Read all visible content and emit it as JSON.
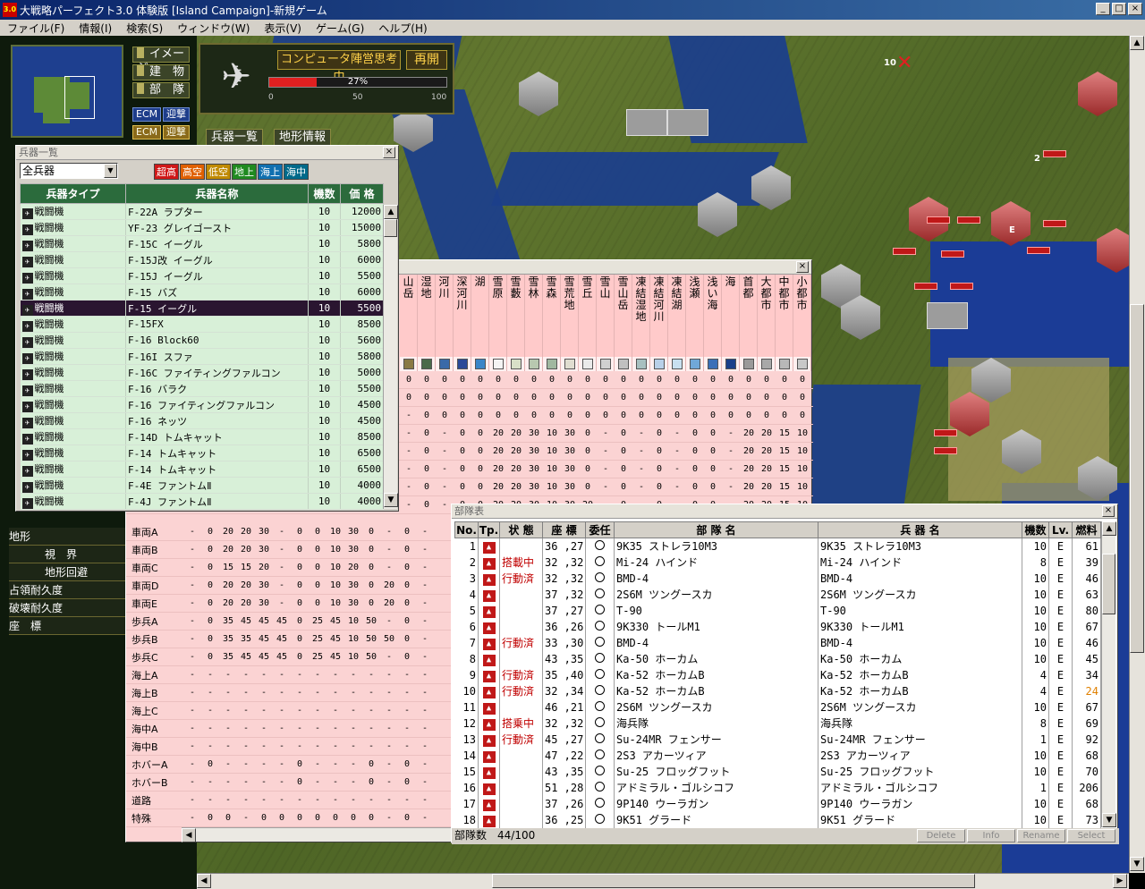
{
  "window": {
    "title": "大戦略パーフェクト3.0 体験版 [Island Campaign]-新規ゲーム",
    "app_icon": "3.0",
    "controls": [
      "_",
      "□",
      "×"
    ]
  },
  "menu": [
    "ファイル(F)",
    "情報(I)",
    "検索(S)",
    "ウィンドウ(W)",
    "表示(V)",
    "ゲーム(G)",
    "ヘルプ(H)"
  ],
  "side_buttons": [
    "イメージ",
    "建　物",
    "部　隊"
  ],
  "ecm_buttons": [
    [
      "ECM",
      "迎撃"
    ],
    [
      "ECM",
      "迎撃"
    ]
  ],
  "status": {
    "message": "コンピュータ陣営思考中",
    "resume": "再開",
    "progress_percent": 27,
    "progress_label": "27%",
    "scale": [
      "0",
      "50",
      "100"
    ]
  },
  "tabs": {
    "weapon_list": "兵器一覧",
    "terrain_info": "地形情報"
  },
  "map_labels": {
    "unit_count": "10",
    "stack_2": "2",
    "enemy_mark": "E"
  },
  "weapon_list": {
    "title": "兵器一覧",
    "filter_value": "全兵器",
    "filter_tags": [
      "超高",
      "高空",
      "低空",
      "地上",
      "海上",
      "海中"
    ],
    "filter_colors": [
      "#d01818",
      "#e06000",
      "#c08a00",
      "#208a20",
      "#1070b0",
      "#006a8a"
    ],
    "headers": [
      "兵器タイプ",
      "兵器名称",
      "機数",
      "価 格"
    ],
    "selected_index": 6,
    "rows": [
      [
        "戦闘機",
        "F-22A ラプター",
        "10",
        "12000"
      ],
      [
        "戦闘機",
        "YF-23 グレイゴースト",
        "10",
        "15000"
      ],
      [
        "戦闘機",
        "F-15C イーグル",
        "10",
        "5800"
      ],
      [
        "戦闘機",
        "F-15J改 イーグル",
        "10",
        "6000"
      ],
      [
        "戦闘機",
        "F-15J イーグル",
        "10",
        "5500"
      ],
      [
        "戦闘機",
        "F-15 バズ",
        "10",
        "6000"
      ],
      [
        "戦闘機",
        "F-15 イーグル",
        "10",
        "5500"
      ],
      [
        "戦闘機",
        "F-15FX",
        "10",
        "8500"
      ],
      [
        "戦闘機",
        "F-16 Block60",
        "10",
        "5600"
      ],
      [
        "戦闘機",
        "F-16I スファ",
        "10",
        "5800"
      ],
      [
        "戦闘機",
        "F-16C ファイティングファルコン",
        "10",
        "5000"
      ],
      [
        "戦闘機",
        "F-16 バラク",
        "10",
        "5500"
      ],
      [
        "戦闘機",
        "F-16 ファイティングファルコン",
        "10",
        "4500"
      ],
      [
        "戦闘機",
        "F-16 ネッツ",
        "10",
        "4500"
      ],
      [
        "戦闘機",
        "F-14D トムキャット",
        "10",
        "8500"
      ],
      [
        "戦闘機",
        "F-14 トムキャット",
        "10",
        "6500"
      ],
      [
        "戦闘機",
        "F-14 トムキャット",
        "10",
        "6500"
      ],
      [
        "戦闘機",
        "F-4E ファントムⅡ",
        "10",
        "4000"
      ],
      [
        "戦闘機",
        "F-4J ファントムⅡ",
        "10",
        "4000"
      ]
    ]
  },
  "terrain": {
    "columns": [
      "山岳",
      "湿地",
      "河川",
      "深河川",
      "湖",
      "雪原",
      "雪藪",
      "雪林",
      "雪森",
      "雪荒地",
      "雪丘",
      "雪山",
      "雪山岳",
      "凍結湿地",
      "凍結河川",
      "凍結湖",
      "浅瀬",
      "浅い海",
      "海",
      "首都",
      "大都市",
      "中都市",
      "小都市"
    ],
    "icon_colors": [
      "#8a7a44",
      "#4a6a4a",
      "#3a6aa8",
      "#2a4a98",
      "#3a86c8",
      "#f4f4f4",
      "#d8e0c8",
      "#b8c8b0",
      "#a0b8a0",
      "#e0ddd0",
      "#eaeaea",
      "#d0d0d0",
      "#c0c0c0",
      "#a8c0c0",
      "#b8d0e8",
      "#c8e0f0",
      "#70a8d8",
      "#3a70b8",
      "#1a408a",
      "#9a9a9a",
      "#a8a8a8",
      "#b8b8b8",
      "#c8c8c8"
    ],
    "upper_rows": [
      [
        "0",
        "0",
        "0",
        "0",
        "0",
        "0",
        "0",
        "0",
        "0",
        "0",
        "0",
        "0",
        "0",
        "0",
        "0",
        "0",
        "0",
        "0",
        "0",
        "0",
        "0",
        "0",
        "0"
      ],
      [
        "0",
        "0",
        "0",
        "0",
        "0",
        "0",
        "0",
        "0",
        "0",
        "0",
        "0",
        "0",
        "0",
        "0",
        "0",
        "0",
        "0",
        "0",
        "0",
        "0",
        "0",
        "0",
        "0"
      ],
      [
        "-",
        "0",
        "0",
        "0",
        "0",
        "0",
        "0",
        "0",
        "0",
        "0",
        "0",
        "0",
        "0",
        "0",
        "0",
        "0",
        "0",
        "0",
        "0",
        "0",
        "0",
        "0",
        "0"
      ],
      [
        "-",
        "0",
        "-",
        "0",
        "0",
        "20",
        "20",
        "30",
        "10",
        "30",
        "0",
        "-",
        "0",
        "-",
        "0",
        "-",
        "0",
        "0",
        "-",
        "20",
        "20",
        "15",
        "10"
      ],
      [
        "-",
        "0",
        "-",
        "0",
        "0",
        "20",
        "20",
        "30",
        "10",
        "30",
        "0",
        "-",
        "0",
        "-",
        "0",
        "-",
        "0",
        "0",
        "-",
        "20",
        "20",
        "15",
        "10"
      ],
      [
        "-",
        "0",
        "-",
        "0",
        "0",
        "20",
        "20",
        "30",
        "10",
        "30",
        "0",
        "-",
        "0",
        "-",
        "0",
        "-",
        "0",
        "0",
        "-",
        "20",
        "20",
        "15",
        "10"
      ],
      [
        "-",
        "0",
        "-",
        "0",
        "0",
        "20",
        "20",
        "30",
        "10",
        "30",
        "0",
        "-",
        "0",
        "-",
        "0",
        "-",
        "0",
        "0",
        "-",
        "20",
        "20",
        "15",
        "10"
      ],
      [
        "-",
        "0",
        "-",
        "0",
        "0",
        "20",
        "20",
        "30",
        "10",
        "30",
        "20",
        "-",
        "0",
        "-",
        "0",
        "-",
        "0",
        "0",
        "-",
        "20",
        "20",
        "15",
        "10"
      ]
    ],
    "lower_rows": [
      {
        "label": "車両A",
        "v": [
          "-",
          "0",
          "20",
          "20",
          "30",
          "-",
          "0",
          "0",
          "10",
          "30",
          "0",
          "-",
          "0",
          "-"
        ]
      },
      {
        "label": "車両B",
        "v": [
          "-",
          "0",
          "20",
          "20",
          "30",
          "-",
          "0",
          "0",
          "10",
          "30",
          "0",
          "-",
          "0",
          "-"
        ]
      },
      {
        "label": "車両C",
        "v": [
          "-",
          "0",
          "15",
          "15",
          "20",
          "-",
          "0",
          "0",
          "10",
          "20",
          "0",
          "-",
          "0",
          "-"
        ]
      },
      {
        "label": "車両D",
        "v": [
          "-",
          "0",
          "20",
          "20",
          "30",
          "-",
          "0",
          "0",
          "10",
          "30",
          "0",
          "20",
          "0",
          "-"
        ]
      },
      {
        "label": "車両E",
        "v": [
          "-",
          "0",
          "20",
          "20",
          "30",
          "-",
          "0",
          "0",
          "10",
          "30",
          "0",
          "20",
          "0",
          "-"
        ]
      },
      {
        "label": "歩兵A",
        "v": [
          "-",
          "0",
          "35",
          "45",
          "45",
          "45",
          "0",
          "25",
          "45",
          "10",
          "50",
          "-",
          "0",
          "-"
        ]
      },
      {
        "label": "歩兵B",
        "v": [
          "-",
          "0",
          "35",
          "35",
          "45",
          "45",
          "0",
          "25",
          "45",
          "10",
          "50",
          "50",
          "0",
          "-"
        ]
      },
      {
        "label": "歩兵C",
        "v": [
          "-",
          "0",
          "35",
          "45",
          "45",
          "45",
          "0",
          "25",
          "45",
          "10",
          "50",
          "-",
          "0",
          "-"
        ]
      },
      {
        "label": "海上A",
        "v": [
          "-",
          "-",
          "-",
          "-",
          "-",
          "-",
          "-",
          "-",
          "-",
          "-",
          "-",
          "-",
          "-",
          "-"
        ]
      },
      {
        "label": "海上B",
        "v": [
          "-",
          "-",
          "-",
          "-",
          "-",
          "-",
          "-",
          "-",
          "-",
          "-",
          "-",
          "-",
          "-",
          "-"
        ]
      },
      {
        "label": "海上C",
        "v": [
          "-",
          "-",
          "-",
          "-",
          "-",
          "-",
          "-",
          "-",
          "-",
          "-",
          "-",
          "-",
          "-",
          "-"
        ]
      },
      {
        "label": "海中A",
        "v": [
          "-",
          "-",
          "-",
          "-",
          "-",
          "-",
          "-",
          "-",
          "-",
          "-",
          "-",
          "-",
          "-",
          "-"
        ]
      },
      {
        "label": "海中B",
        "v": [
          "-",
          "-",
          "-",
          "-",
          "-",
          "-",
          "-",
          "-",
          "-",
          "-",
          "-",
          "-",
          "-",
          "-"
        ]
      },
      {
        "label": "ホバーA",
        "v": [
          "-",
          "0",
          "-",
          "-",
          "-",
          "-",
          "0",
          "-",
          "-",
          "-",
          "0",
          "-",
          "0",
          "-"
        ]
      },
      {
        "label": "ホバーB",
        "v": [
          "-",
          "-",
          "-",
          "-",
          "-",
          "-",
          "0",
          "-",
          "-",
          "-",
          "0",
          "-",
          "0",
          "-"
        ]
      },
      {
        "label": "道路",
        "v": [
          "-",
          "-",
          "-",
          "-",
          "-",
          "-",
          "-",
          "-",
          "-",
          "-",
          "-",
          "-",
          "-",
          "-"
        ]
      },
      {
        "label": "特殊",
        "v": [
          "-",
          "0",
          "0",
          "-",
          "0",
          "0",
          "0",
          "0",
          "0",
          "0",
          "0",
          "-",
          "0",
          "-"
        ]
      }
    ]
  },
  "left_labels": [
    "地形",
    "視　界",
    "地形回避",
    "占領耐久度",
    "破壊耐久度",
    "座　標"
  ],
  "unit_table": {
    "title": "部隊表",
    "headers": [
      "No.",
      "Tp.",
      "状 態",
      "座 標",
      "委任",
      "部 隊 名",
      "兵 器 名",
      "機数",
      "Lv.",
      "燃料"
    ],
    "rows": [
      [
        "1",
        "",
        "36",
        "27",
        "9K35 ストレラ10M3",
        "9K35 ストレラ10M3",
        "10",
        "E",
        "61"
      ],
      [
        "2",
        "搭載中",
        "32",
        "32",
        "Mi-24 ハインド",
        "Mi-24 ハインド",
        "8",
        "E",
        "39"
      ],
      [
        "3",
        "行動済",
        "32",
        "32",
        "BMD-4",
        "BMD-4",
        "10",
        "E",
        "46"
      ],
      [
        "4",
        "",
        "37",
        "32",
        "2S6M ツングースカ",
        "2S6M ツングースカ",
        "10",
        "E",
        "63"
      ],
      [
        "5",
        "",
        "37",
        "27",
        "T-90",
        "T-90",
        "10",
        "E",
        "80"
      ],
      [
        "6",
        "",
        "36",
        "26",
        "9K330 トールM1",
        "9K330 トールM1",
        "10",
        "E",
        "67"
      ],
      [
        "7",
        "行動済",
        "33",
        "30",
        "BMD-4",
        "BMD-4",
        "10",
        "E",
        "46"
      ],
      [
        "8",
        "",
        "43",
        "35",
        "Ka-50 ホーカム",
        "Ka-50 ホーカム",
        "10",
        "E",
        "45"
      ],
      [
        "9",
        "行動済",
        "35",
        "40",
        "Ka-52 ホーカムB",
        "Ka-52 ホーカムB",
        "4",
        "E",
        "34"
      ],
      [
        "10",
        "行動済",
        "32",
        "34",
        "Ka-52 ホーカムB",
        "Ka-52 ホーカムB",
        "4",
        "E",
        "24"
      ],
      [
        "11",
        "",
        "46",
        "21",
        "2S6M ツングースカ",
        "2S6M ツングースカ",
        "10",
        "E",
        "67"
      ],
      [
        "12",
        "搭乗中",
        "32",
        "32",
        "海兵隊",
        "海兵隊",
        "8",
        "E",
        "69"
      ],
      [
        "13",
        "行動済",
        "45",
        "27",
        "Su-24MR フェンサー",
        "Su-24MR フェンサー",
        "1",
        "E",
        "92"
      ],
      [
        "14",
        "",
        "47",
        "22",
        "2S3 アカーツィア",
        "2S3 アカーツィア",
        "10",
        "E",
        "68"
      ],
      [
        "15",
        "",
        "43",
        "35",
        "Su-25 フロッグフット",
        "Su-25 フロッグフット",
        "10",
        "E",
        "70"
      ],
      [
        "16",
        "",
        "51",
        "28",
        "アドミラル・ゴルシコフ",
        "アドミラル・ゴルシコフ",
        "1",
        "E",
        "206"
      ],
      [
        "17",
        "",
        "37",
        "26",
        "9P140 ウーラガン",
        "9P140 ウーラガン",
        "10",
        "E",
        "68"
      ],
      [
        "18",
        "",
        "36",
        "25",
        "9K51 グラード",
        "9K51 グラード",
        "10",
        "E",
        "73"
      ]
    ],
    "footer": "部隊数　44/100",
    "buttons": [
      "Delete",
      "Info",
      "Rename",
      "Select"
    ]
  }
}
